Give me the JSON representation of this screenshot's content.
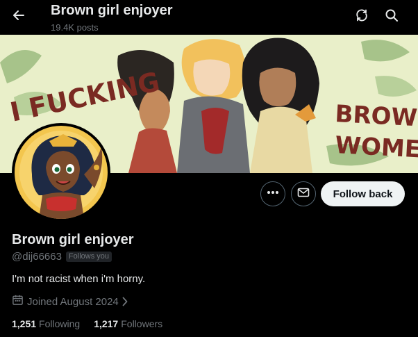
{
  "header": {
    "title": "Brown girl enjoyer",
    "post_count": "19.4K posts",
    "back_icon": "arrow-left-icon",
    "refresh_icon": "refresh-icon",
    "search_icon": "search-icon"
  },
  "banner": {
    "left_text_line1": "I FUCKING",
    "right_text_line1": "BROWN",
    "right_text_line2": "WOMEN!"
  },
  "actions": {
    "more_icon": "more-horizontal-icon",
    "message_icon": "envelope-icon",
    "follow_label": "Follow back"
  },
  "profile": {
    "display_name": "Brown girl enjoyer",
    "handle": "@dij66663",
    "follows_you": "Follows you",
    "bio": "I'm not racist when i'm horny.",
    "joined": "Joined August 2024",
    "following_count": "1,251",
    "following_label": "Following",
    "followers_count": "1,217",
    "followers_label": "Followers"
  },
  "colors": {
    "background": "#000000",
    "primary_text": "#e7e9ea",
    "secondary_text": "#71767b",
    "follow_button_bg": "#eff3f4",
    "banner_bg": "#e9efc9",
    "banner_text": "#7a2a22"
  }
}
